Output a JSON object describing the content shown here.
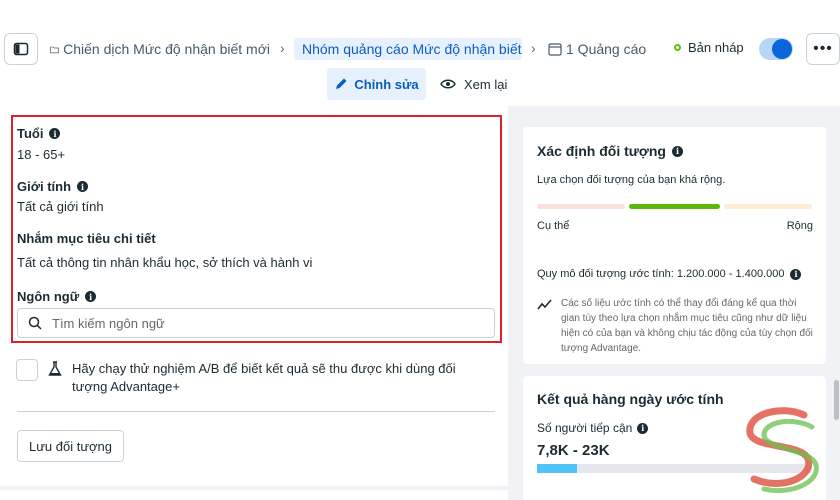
{
  "breadcrumbs": [
    {
      "label": "Chiến dịch Mức độ nhận biết mới",
      "icon": "folder-icon"
    },
    {
      "label": "Nhóm quảng cáo Mức độ nhận biết",
      "icon": "grid-icon"
    },
    {
      "label": "1 Quảng cáo",
      "icon": "ad-icon"
    }
  ],
  "status": {
    "label": "Bản nháp",
    "color": "#63be09"
  },
  "tabs": {
    "edit": "Chỉnh sửa",
    "review": "Xem lại"
  },
  "audience": {
    "age_label": "Tuổi",
    "age_value": "18 - 65+",
    "gender_label": "Giới tính",
    "gender_value": "Tất cả giới tính",
    "detailed_label": "Nhắm mục tiêu chi tiết",
    "detailed_value": "Tất cả thông tin nhân khẩu học, sở thích và hành vi",
    "language_label": "Ngôn ngữ",
    "language_placeholder": "Tìm kiếm ngôn ngữ"
  },
  "ab_test": {
    "text": "Hãy chạy thử nghiệm A/B để biết kết quả sẽ thu được khi dùng đối tượng Advantage+"
  },
  "save_button": "Lưu đối tượng",
  "definition_card": {
    "title": "Xác định đối tượng",
    "subtitle": "Lựa chọn đối tượng của bạn khá rộng.",
    "left_label": "Cụ thể",
    "right_label": "Rộng",
    "size_text": "Quy mô đối tượng ước tính: 1.200.000 - 1.400.000",
    "note": "Các số liệu ước tính có thể thay đổi đáng kể qua thời gian tùy theo lựa chọn nhắm mục tiêu cũng như dữ liệu hiện có của bạn và không chịu tác động của tùy chọn đối tượng Advantage.",
    "colors": {
      "specific": "#f8e0dc",
      "active": "#5fb709",
      "broad": "#fdedd3"
    }
  },
  "results_card": {
    "title": "Kết quả hàng ngày ước tính",
    "reach_label": "Số người tiếp cận",
    "reach_value": "7,8K - 23K"
  },
  "colors": {
    "accent": "#0866d8",
    "highlight_border": "#d9252a"
  }
}
